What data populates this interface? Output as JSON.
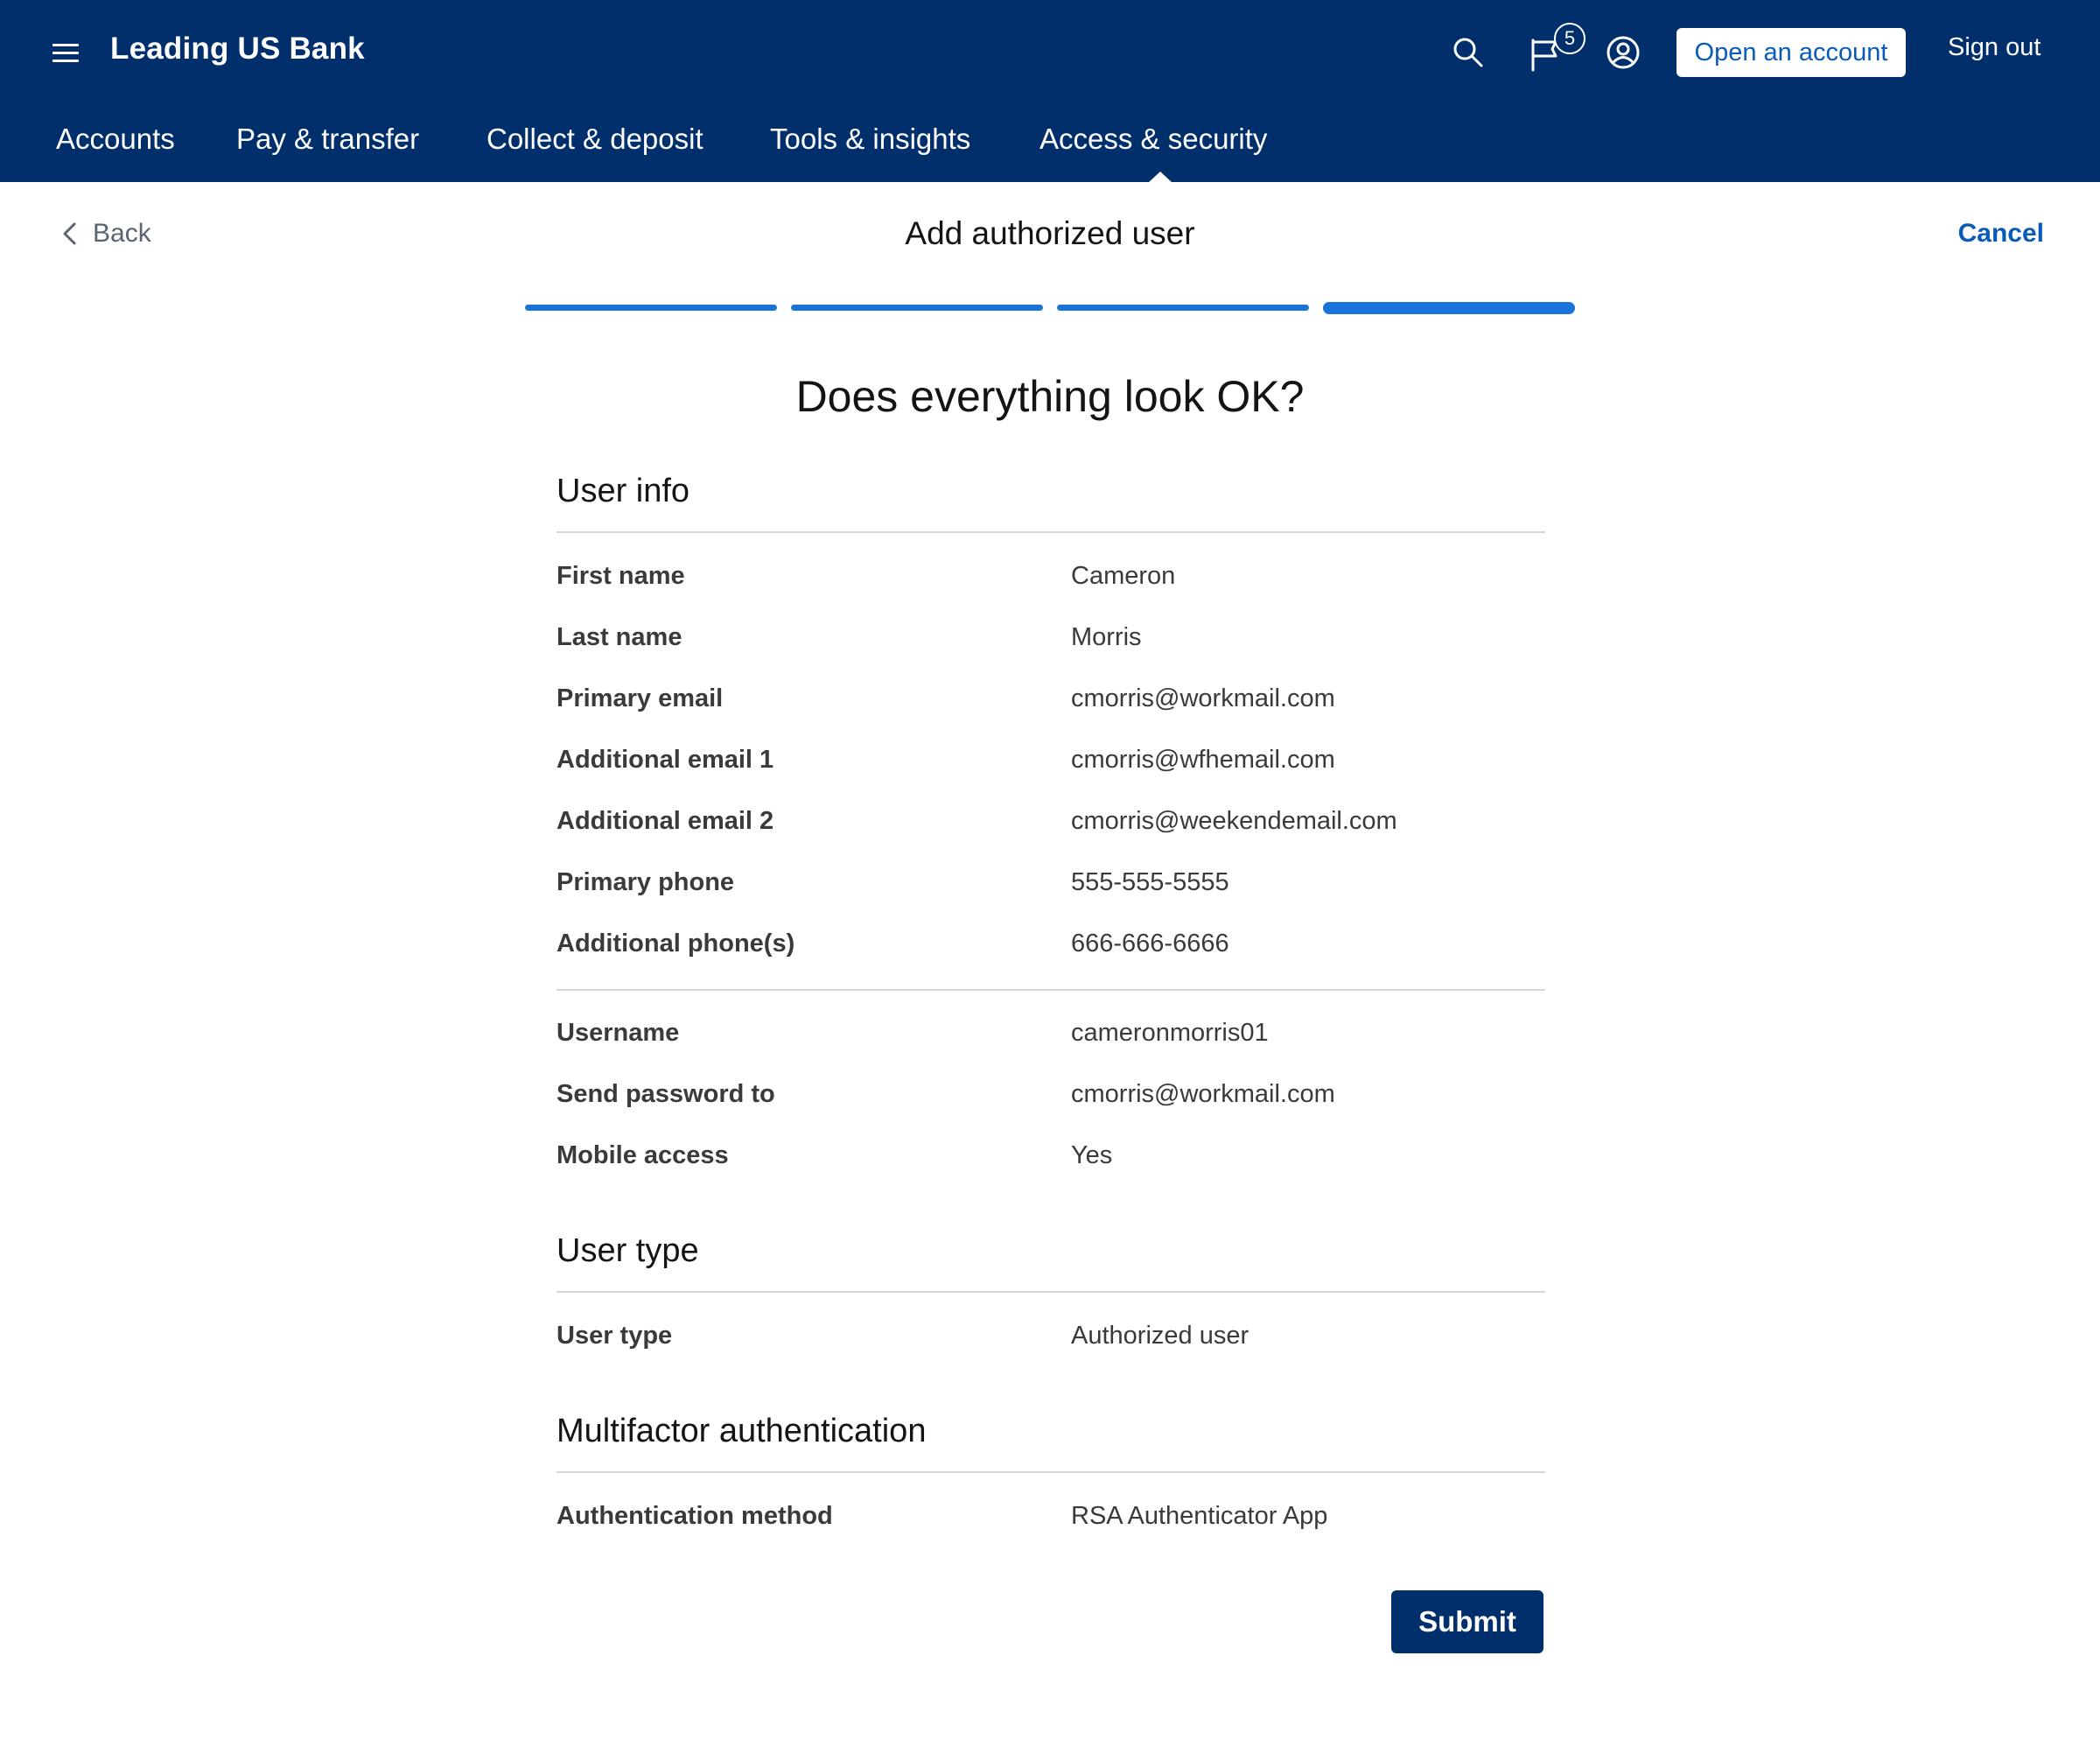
{
  "header": {
    "brand": "Leading US Bank",
    "notification_count": "5",
    "open_account_label": "Open an account",
    "sign_out_label": "Sign out",
    "icons": [
      "menu-icon",
      "search-icon",
      "flag-icon",
      "profile-icon"
    ]
  },
  "nav": {
    "items": [
      {
        "label": "Accounts"
      },
      {
        "label": "Pay & transfer"
      },
      {
        "label": "Collect & deposit"
      },
      {
        "label": "Tools & insights"
      },
      {
        "label": "Access & security"
      }
    ],
    "active": "Access & security"
  },
  "page": {
    "back_label": "Back",
    "title": "Add authorized user",
    "cancel_label": "Cancel",
    "steps_total": 4,
    "current_step": 4,
    "question": "Does everything look OK?"
  },
  "user_info": {
    "heading": "User info",
    "rows": [
      {
        "label": "First name",
        "value": "Cameron"
      },
      {
        "label": "Last name",
        "value": "Morris"
      },
      {
        "label": "Primary email",
        "value": "cmorris@workmail.com"
      },
      {
        "label": "Additional email 1",
        "value": "cmorris@wfhemail.com"
      },
      {
        "label": "Additional email 2",
        "value": "cmorris@weekendemail.com"
      },
      {
        "label": "Primary phone",
        "value": "555-555-5555"
      },
      {
        "label": "Additional phone(s)",
        "value": "666-666-6666"
      }
    ],
    "login_rows": [
      {
        "label": "Username",
        "value": "cameronmorris01"
      },
      {
        "label": "Send password to",
        "value": "cmorris@workmail.com"
      },
      {
        "label": "Mobile access",
        "value": "Yes"
      }
    ]
  },
  "user_type": {
    "heading": "User type",
    "rows": [
      {
        "label": "User type",
        "value": "Authorized user"
      }
    ]
  },
  "mfa": {
    "heading": "Multifactor authentication",
    "rows": [
      {
        "label": "Authentication method",
        "value": "RSA Authenticator App"
      }
    ]
  },
  "actions": {
    "submit_label": "Submit"
  },
  "colors": {
    "header_bg": "#002f6c",
    "link_blue": "#0a5bb8",
    "progress_blue": "#1a73d8"
  }
}
